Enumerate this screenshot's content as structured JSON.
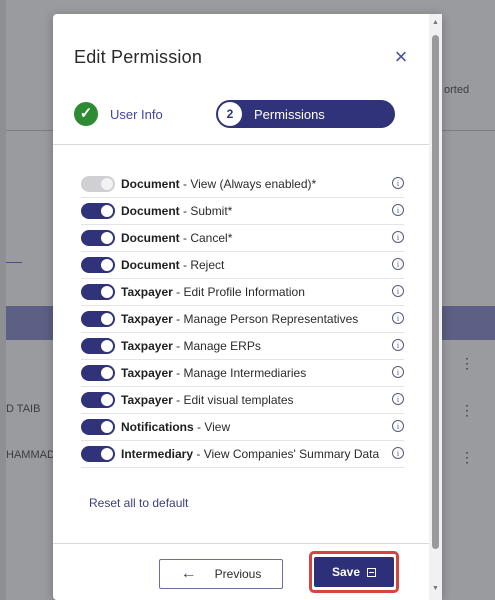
{
  "background": {
    "fragment_top": "orted",
    "row_names": [
      "D TAIB",
      "HAMMAD"
    ],
    "menu_glyph": "⋮"
  },
  "modal": {
    "title": "Edit Permission",
    "close_icon": "×",
    "stepper": {
      "step1": {
        "label": "User Info",
        "icon": "check-icon"
      },
      "step2": {
        "number": "2",
        "label": "Permissions"
      }
    },
    "permissions": [
      {
        "category": "Document",
        "action": " - View (Always enabled)*",
        "enabled": true,
        "locked": true
      },
      {
        "category": "Document",
        "action": " - Submit*",
        "enabled": true,
        "locked": false
      },
      {
        "category": "Document",
        "action": " - Cancel*",
        "enabled": true,
        "locked": false
      },
      {
        "category": "Document",
        "action": " - Reject",
        "enabled": true,
        "locked": false
      },
      {
        "category": "Taxpayer",
        "action": " - Edit Profile Information",
        "enabled": true,
        "locked": false
      },
      {
        "category": "Taxpayer",
        "action": " - Manage Person Representatives",
        "enabled": true,
        "locked": false
      },
      {
        "category": "Taxpayer",
        "action": " - Manage ERPs",
        "enabled": true,
        "locked": false
      },
      {
        "category": "Taxpayer",
        "action": " - Manage Intermediaries",
        "enabled": true,
        "locked": false
      },
      {
        "category": "Taxpayer",
        "action": " - Edit visual templates",
        "enabled": true,
        "locked": false
      },
      {
        "category": "Notifications",
        "action": " - View",
        "enabled": true,
        "locked": false
      },
      {
        "category": "Intermediary",
        "action": " - View Companies' Summary Data",
        "enabled": true,
        "locked": false
      }
    ],
    "info_glyph": "i",
    "reset_label": "Reset all to default",
    "footer": {
      "previous_label": "Previous",
      "previous_arrow": "←",
      "save_label": "Save"
    }
  },
  "colors": {
    "primary": "#30337a",
    "success": "#2e8b34",
    "highlight": "#d6453d"
  }
}
